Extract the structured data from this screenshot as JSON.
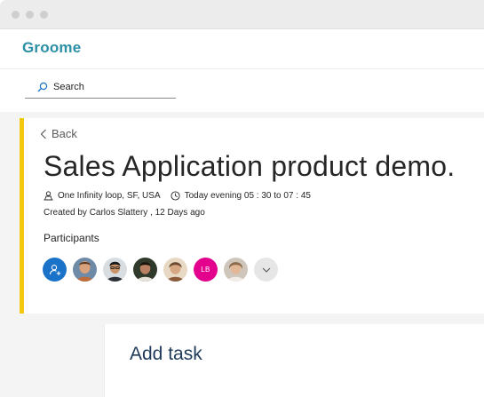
{
  "app": {
    "name": "Groome"
  },
  "search": {
    "placeholder": "Search"
  },
  "event": {
    "back_label": "Back",
    "title": "Sales Application product demo.",
    "location": "One Infinity loop, SF, USA",
    "time": "Today evening 05 : 30 to 07 : 45",
    "created": "Created by Carlos Slattery , 12 Days ago",
    "participants_label": "Participants",
    "participants": [
      {
        "type": "add-person",
        "icon": "add-person-icon"
      },
      {
        "type": "photo"
      },
      {
        "type": "photo"
      },
      {
        "type": "photo"
      },
      {
        "type": "initials",
        "initials": "LB"
      },
      {
        "type": "photo"
      },
      {
        "type": "more",
        "icon": "chevron-down-icon"
      }
    ]
  },
  "task": {
    "title": "Add task"
  },
  "colors": {
    "brand": "#2b8fa6",
    "accent_bar": "#f2c811",
    "add_avatar": "#1a73c9",
    "initials_avatar": "#e3008c"
  }
}
